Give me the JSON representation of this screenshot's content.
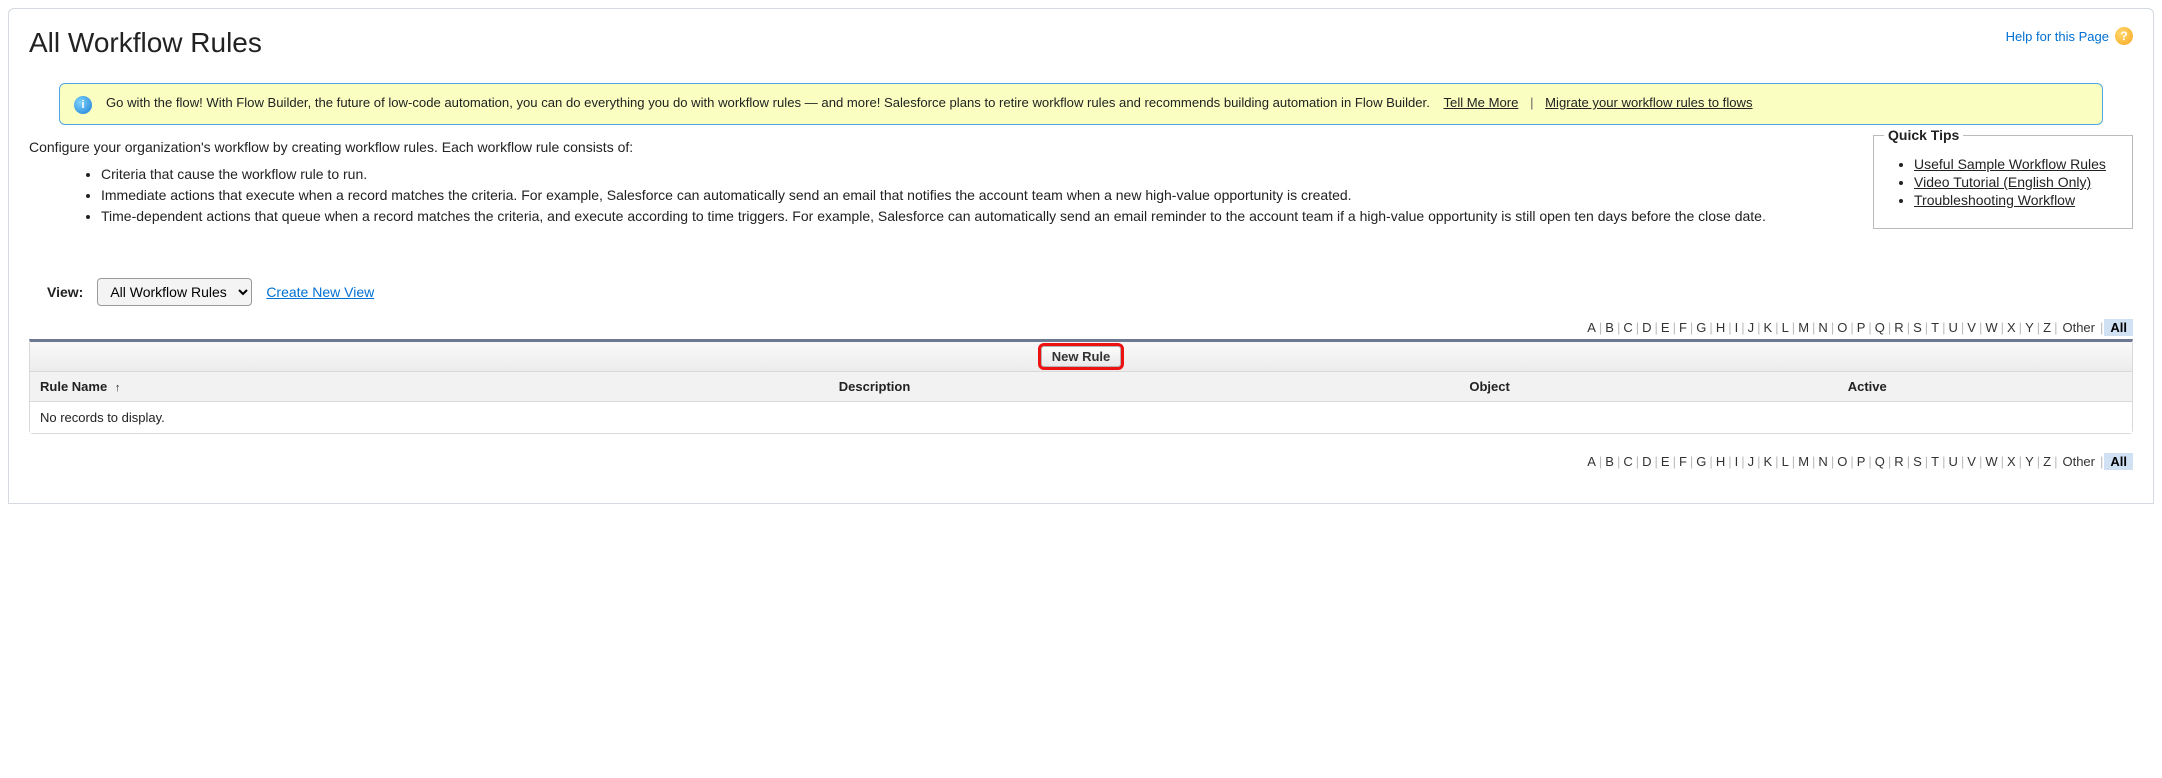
{
  "header": {
    "title": "All Workflow Rules",
    "help_label": "Help for this Page"
  },
  "alert": {
    "text": "Go with the flow! With Flow Builder, the future of low-code automation, you can do everything you do with workflow rules — and more! Salesforce plans to retire workflow rules and recommends building automation in Flow Builder.",
    "tell_more": "Tell Me More",
    "migrate": "Migrate your workflow rules to flows"
  },
  "intro": {
    "lead": "Configure your organization's workflow by creating workflow rules. Each workflow rule consists of:",
    "bullets": [
      "Criteria that cause the workflow rule to run.",
      "Immediate actions that execute when a record matches the criteria. For example, Salesforce can automatically send an email that notifies the account team when a new high-value opportunity is created.",
      "Time-dependent actions that queue when a record matches the criteria, and execute according to time triggers. For example, Salesforce can automatically send an email reminder to the account team if a high-value opportunity is still open ten days before the close date."
    ]
  },
  "quicktips": {
    "title": "Quick Tips",
    "links": [
      "Useful Sample Workflow Rules",
      "Video Tutorial (English Only)",
      "Troubleshooting Workflow"
    ]
  },
  "view": {
    "label": "View:",
    "selected": "All Workflow Rules",
    "create": "Create New View"
  },
  "alpha": {
    "letters": [
      "A",
      "B",
      "C",
      "D",
      "E",
      "F",
      "G",
      "H",
      "I",
      "J",
      "K",
      "L",
      "M",
      "N",
      "O",
      "P",
      "Q",
      "R",
      "S",
      "T",
      "U",
      "V",
      "W",
      "X",
      "Y",
      "Z"
    ],
    "other": "Other",
    "all": "All"
  },
  "table": {
    "new_rule": "New Rule",
    "cols": {
      "rule_name": "Rule Name",
      "description": "Description",
      "object": "Object",
      "active": "Active"
    },
    "empty": "No records to display."
  }
}
